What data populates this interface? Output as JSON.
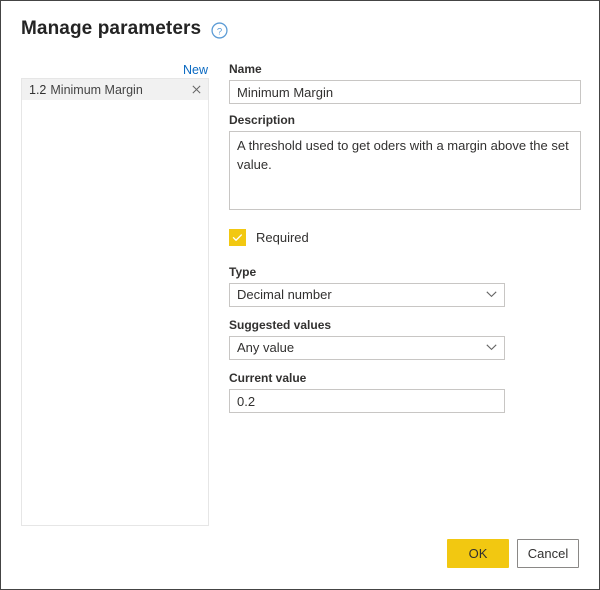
{
  "dialog": {
    "title": "Manage parameters",
    "help_icon": "help-circle-icon"
  },
  "list_panel": {
    "new_label": "New",
    "items": [
      {
        "index": "1.2",
        "label": "Minimum Margin",
        "close_icon": "close-icon"
      }
    ]
  },
  "form": {
    "name": {
      "label": "Name",
      "value": "Minimum Margin"
    },
    "description": {
      "label": "Description",
      "value": "A threshold used to get oders with a margin above the set value."
    },
    "required": {
      "label": "Required",
      "checked": true,
      "checkbox_color": "#f2c811"
    },
    "type": {
      "label": "Type",
      "value": "Decimal number"
    },
    "suggested_values": {
      "label": "Suggested values",
      "value": "Any value"
    },
    "current_value": {
      "label": "Current value",
      "value": "0.2"
    }
  },
  "footer": {
    "ok_label": "OK",
    "cancel_label": "Cancel",
    "primary_color": "#f2c811"
  }
}
